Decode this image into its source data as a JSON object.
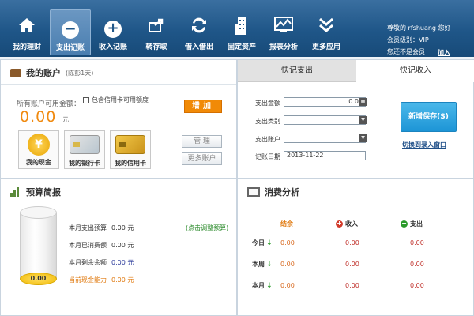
{
  "nav": [
    {
      "label": "我的理财",
      "icon": "home-icon"
    },
    {
      "label": "支出记账",
      "icon": "minus-circle-icon"
    },
    {
      "label": "收入记账",
      "icon": "plus-circle-icon"
    },
    {
      "label": "转存取",
      "icon": "transfer-icon"
    },
    {
      "label": "借入借出",
      "icon": "exchange-icon"
    },
    {
      "label": "固定资产",
      "icon": "building-icon"
    },
    {
      "label": "报表分析",
      "icon": "chart-icon"
    },
    {
      "label": "更多应用",
      "icon": "chevrons-down-icon"
    }
  ],
  "user": {
    "greeting": "尊敬的 rfshuang 您好",
    "level": "会员级别：VIP",
    "status": "您还不是会员",
    "join": "加入会员"
  },
  "account": {
    "title": "我的账户",
    "subtitle": "(陈彭1天)",
    "all_label": "所有账户可用金额：",
    "include_credit": "包含信用卡可用额度",
    "add": "增加",
    "amount": "0.00",
    "unit": "元",
    "cards": [
      {
        "label": "我的现金",
        "icon": "coin-icon"
      },
      {
        "label": "我的银行卡",
        "icon": "bank-card-icon"
      },
      {
        "label": "我的信用卡",
        "icon": "credit-card-icon"
      }
    ],
    "manage": "管 理",
    "more": "更多账户"
  },
  "entry": {
    "tab_active": "快记支出",
    "tab_other": "快记收入",
    "amount_label": "支出金额",
    "amount_value": "0.00",
    "category_label": "支出类别",
    "account_label": "支出账户",
    "date_label": "记账日期",
    "date_value": "2013-11-22",
    "save": "新增保存(S)",
    "switch": "切换到录入窗口"
  },
  "budget": {
    "title": "预算简报",
    "cyl_value": "0.00",
    "adjust": "(点击调整预算)",
    "rows": [
      {
        "label": "本月支出预算",
        "value": "0.00 元"
      },
      {
        "label": "本月已消费额",
        "value": "0.00 元"
      },
      {
        "label": "本月剩余余额",
        "value": "0.00 元"
      },
      {
        "label": "当前现金能力",
        "value": "0.00 元"
      }
    ]
  },
  "consumption": {
    "title": "消费分析",
    "headers": {
      "balance": "结余",
      "income": "收入",
      "expense": "支出"
    },
    "rows": [
      {
        "label": "今日",
        "balance": "0.00",
        "income": "0.00",
        "expense": "0.00"
      },
      {
        "label": "本周",
        "balance": "0.00",
        "income": "0.00",
        "expense": "0.00"
      },
      {
        "label": "本月",
        "balance": "0.00",
        "income": "0.00",
        "expense": "0.00"
      }
    ]
  },
  "colors": {
    "toolbar": "#1f5688",
    "accent": "#f18a07",
    "save": "#1d95d6",
    "income": "#c0302a",
    "expense": "#2a9a2a"
  }
}
